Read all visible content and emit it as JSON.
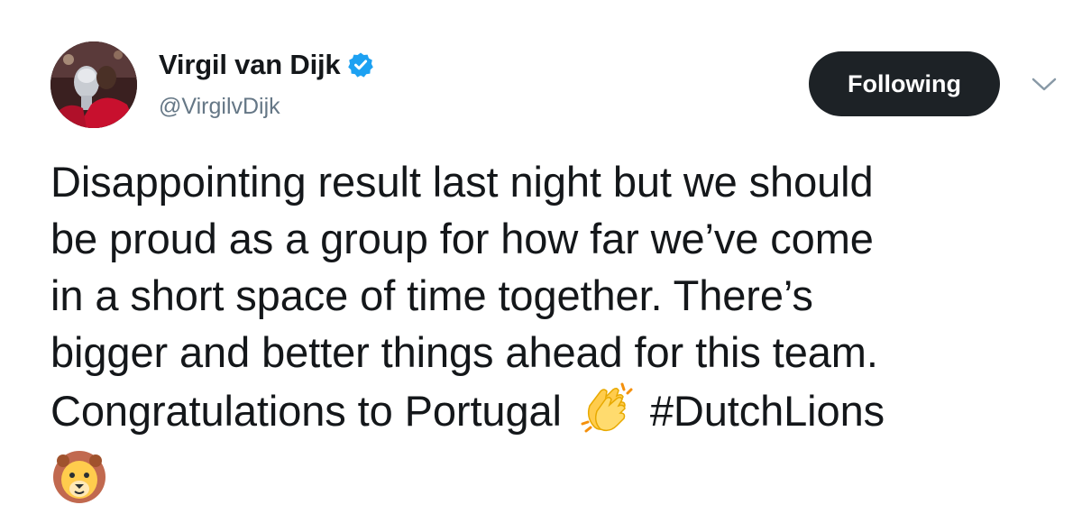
{
  "user": {
    "display_name": "Virgil van Dijk",
    "handle": "@VirgilvDijk",
    "verified": true
  },
  "actions": {
    "follow_label": "Following"
  },
  "tweet": {
    "lines": [
      "Disappointing result last night but we should",
      "be proud as a group for how far we’ve come",
      "in a short space of time together. There’s",
      "bigger and better things ahead for this team.",
      "Congratulations to Portugal"
    ],
    "hashtag": "#DutchLions",
    "emojis": [
      "clapping-hands",
      "lion-face"
    ]
  },
  "colors": {
    "verified_badge": "#1da1f2",
    "button_bg": "#1d2226",
    "handle_text": "#657786",
    "body_text": "#14171a"
  }
}
